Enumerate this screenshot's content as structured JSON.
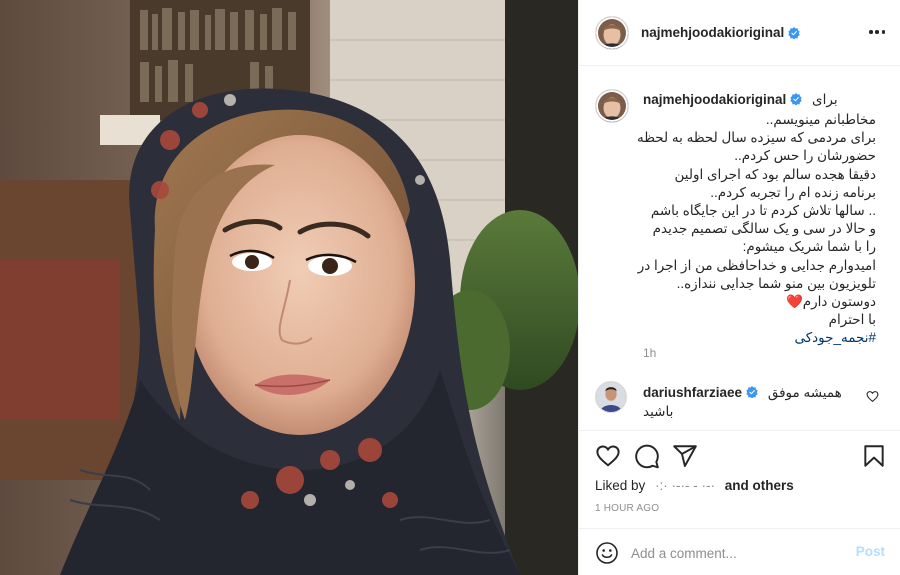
{
  "post": {
    "author": "najmehjoodakioriginal",
    "verified_icon": "verified-badge-icon",
    "more_icon": "more-options-icon"
  },
  "caption": {
    "username": "najmehjoodakioriginal",
    "first_word": "برای",
    "lines": [
      "مخاطبانم مینویسم..",
      "برای مردمی که سیزده سال لحظه به لحظه",
      "حضورشان را حس کردم..",
      "دقیقا هجده سالم بود که اجرای اولین",
      "برنامه زنده ام را تجربه کردم..",
      ".. سالها تلاش کردم تا در این جایگاه باشم",
      "و حالا در سی و یک سالگی تصمیم جدیدم",
      "را با شما شریک میشوم:",
      "امیدوارم جدایی و خداحافظی من از اجرا در",
      "تلویزیون بین منو شما جدایی نندازه..",
      "دوستون دارم❤️",
      "با احترام"
    ],
    "hashtag": "#نجمه_جودکی",
    "time": "1h"
  },
  "comment": {
    "username": "dariushfarziaee",
    "text_line1": "همیشه موفق",
    "text_line2": "باشید"
  },
  "actions": {
    "like_icon": "heart-icon",
    "comment_icon": "comment-bubble-icon",
    "share_icon": "paper-plane-icon",
    "save_icon": "bookmark-icon",
    "liked_by_prefix": "Liked by",
    "liked_by_names": "·:·    ·-·-    -   ·-·",
    "and_others": "and others",
    "posted_time": "1 HOUR AGO"
  },
  "add_comment": {
    "emoji_icon": "smiley-icon",
    "placeholder": "Add a comment...",
    "post_label": "Post"
  },
  "colors": {
    "text": "#262626",
    "muted": "#8e8e8e",
    "link": "#00376b",
    "verified": "#3897f0",
    "post_disabled": "#b2dffc",
    "heart_red": "#ed4956"
  }
}
